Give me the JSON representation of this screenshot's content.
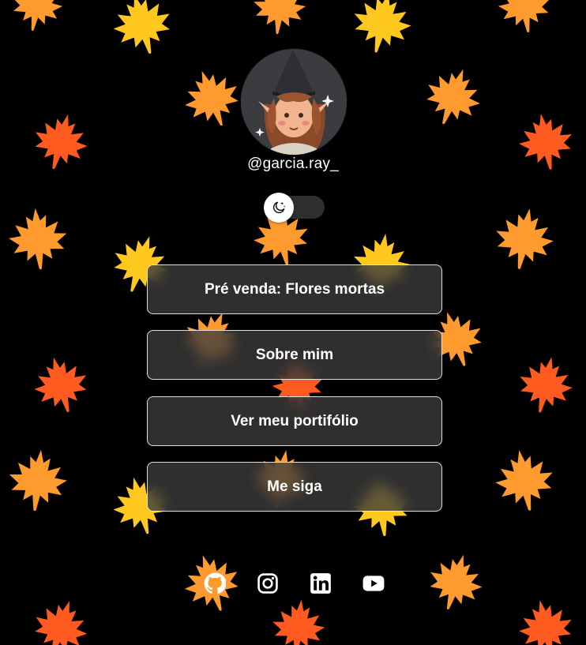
{
  "profile": {
    "username": "@garcia.ray_"
  },
  "theme_toggle": {
    "icon": "moon-stars-icon",
    "state": "dark"
  },
  "links": [
    {
      "label": "Pré venda: Flores mortas"
    },
    {
      "label": "Sobre mim"
    },
    {
      "label": "Ver meu portifólio"
    },
    {
      "label": "Me siga"
    }
  ],
  "social": [
    {
      "name": "github-icon"
    },
    {
      "name": "instagram-icon"
    },
    {
      "name": "linkedin-icon"
    },
    {
      "name": "youtube-icon"
    }
  ],
  "colors": {
    "background": "#000000",
    "leaf_yellow": "#FFC81E",
    "leaf_orange": "#FF9A2E",
    "leaf_red_orange": "#FF5A1F",
    "button_fill": "#3C3C3C",
    "text": "#FFFFFF"
  }
}
